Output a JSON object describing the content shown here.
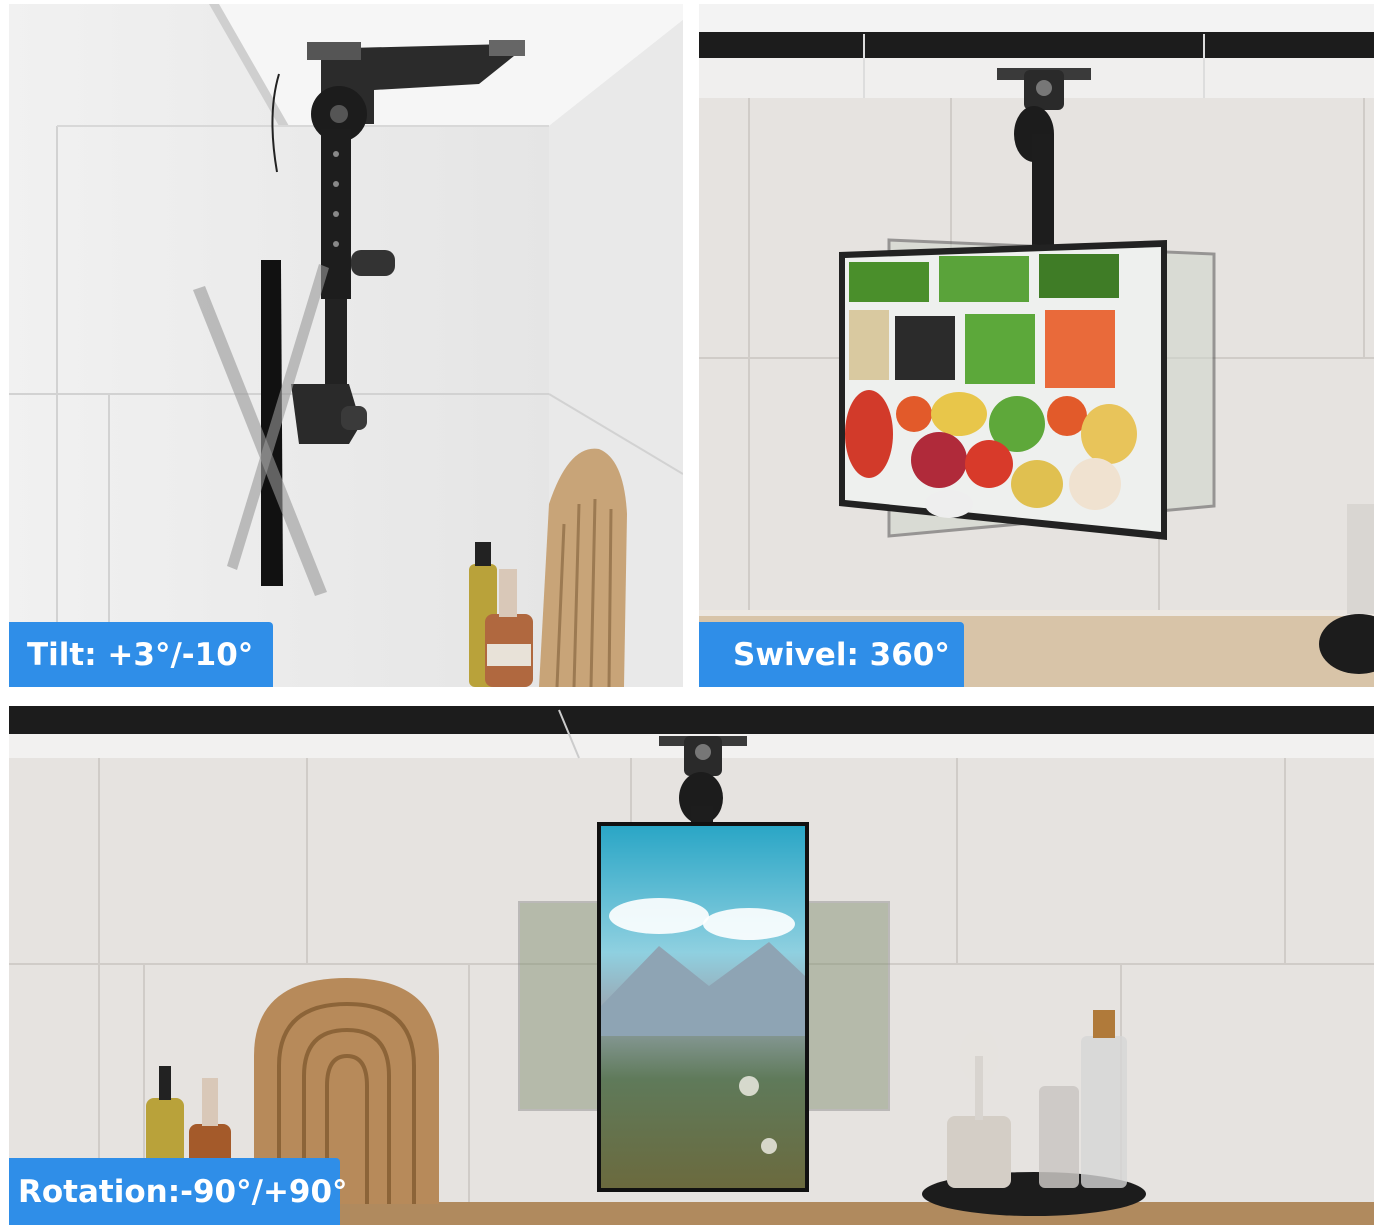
{
  "panels": {
    "tilt": {
      "label": "Tilt: +3°/-10°"
    },
    "swivel": {
      "label": "Swivel: 360°"
    },
    "rotation": {
      "label": "Rotation:-90°/+90°"
    }
  },
  "colors": {
    "label_bg": "#2f8ee8",
    "label_text": "#ffffff",
    "wall": "#e4e2e0",
    "tile_line": "#cfccc9",
    "cabinet": "#1c1c1c",
    "mount_metal": "#1a1a1a",
    "counter_wood": "#b08a5e"
  },
  "icons": [
    "ceiling-mount-bracket-icon",
    "tv-screen-icon",
    "cutting-board-icon",
    "bottle-icon"
  ]
}
